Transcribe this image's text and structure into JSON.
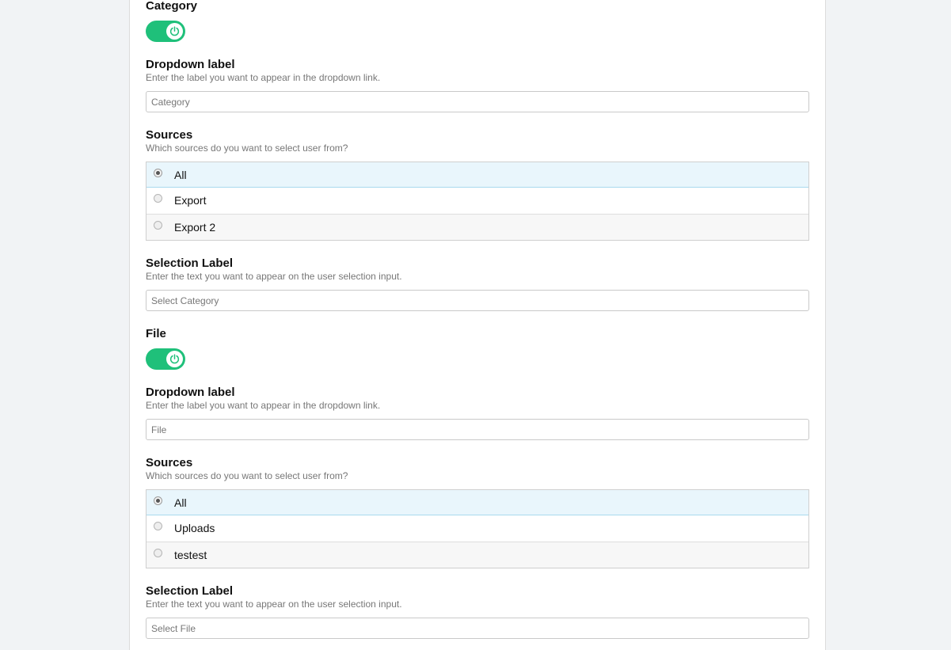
{
  "sections": [
    {
      "title": "Category",
      "toggle": {
        "on": true,
        "icon": "power-icon"
      },
      "dropdown": {
        "label": "Dropdown label",
        "help": "Enter the label you want to appear in the dropdown link.",
        "placeholder": "Category"
      },
      "sources": {
        "label": "Sources",
        "help": "Which sources do you want to select user from?",
        "selected": "All",
        "options": [
          "All",
          "Export",
          "Export 2"
        ]
      },
      "selection": {
        "label": "Selection Label",
        "help": "Enter the text you want to appear on the user selection input.",
        "placeholder": "Select Category"
      }
    },
    {
      "title": "File",
      "toggle": {
        "on": true,
        "icon": "power-icon"
      },
      "dropdown": {
        "label": "Dropdown label",
        "help": "Enter the label you want to appear in the dropdown link.",
        "placeholder": "File"
      },
      "sources": {
        "label": "Sources",
        "help": "Which sources do you want to select user from?",
        "selected": "All",
        "options": [
          "All",
          "Uploads",
          "testest"
        ]
      },
      "selection": {
        "label": "Selection Label",
        "help": "Enter the text you want to appear on the user selection input.",
        "placeholder": "Select File"
      }
    }
  ],
  "colors": {
    "toggle_on": "#1fc07a",
    "selected_row": "#e9f6fc",
    "page_background": "#f1f3f5"
  }
}
